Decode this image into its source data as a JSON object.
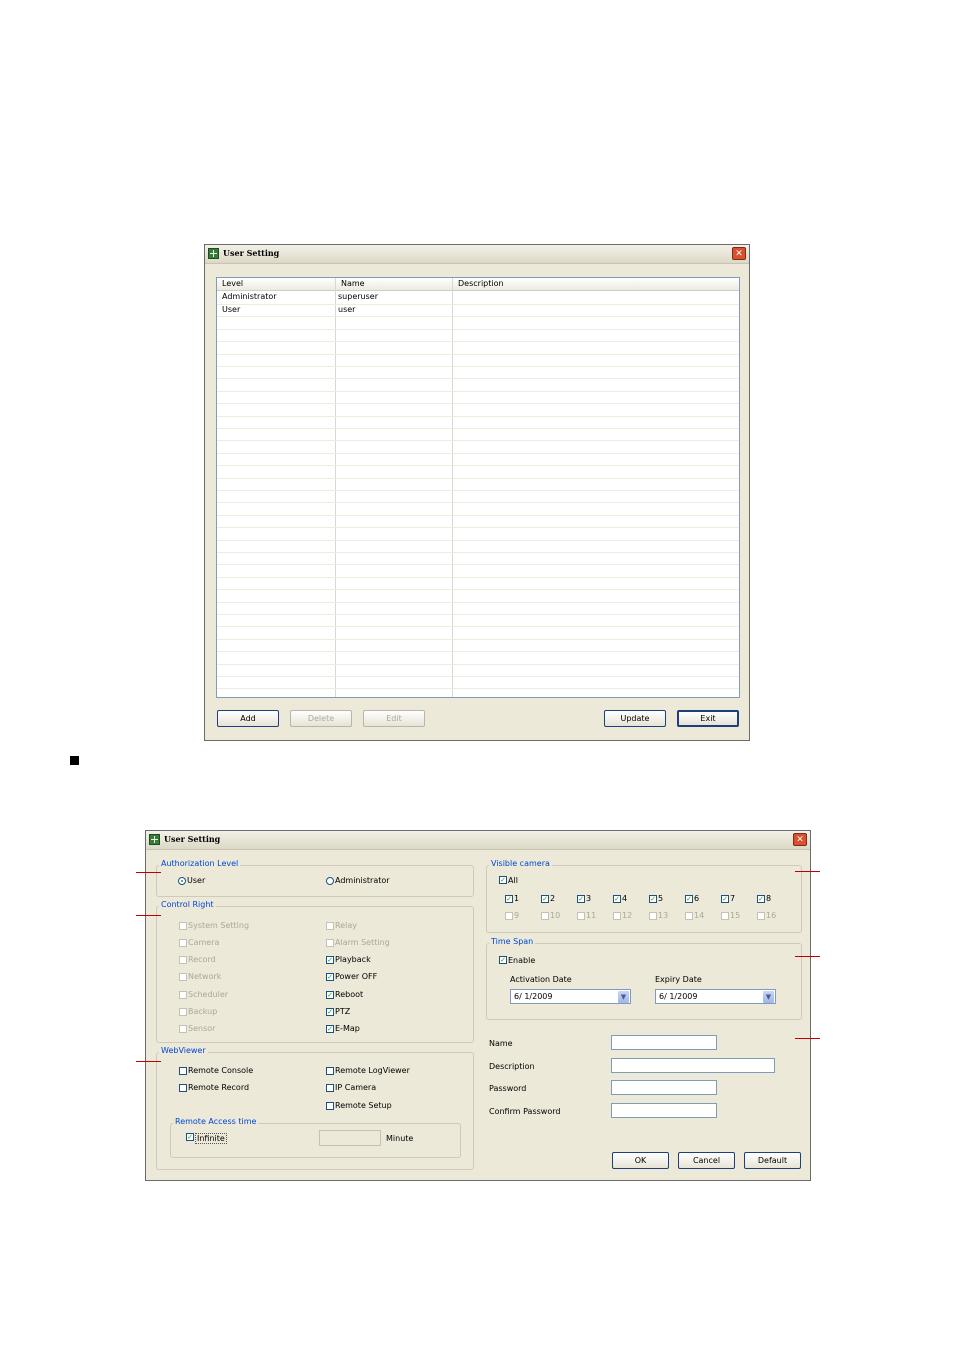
{
  "dialog1": {
    "title": "User Setting",
    "columns": [
      "Level",
      "Name",
      "Description"
    ],
    "rows": [
      {
        "level": "Administrator",
        "name": "superuser",
        "description": ""
      },
      {
        "level": "User",
        "name": "user",
        "description": ""
      }
    ],
    "buttons": {
      "add": "Add",
      "delete": "Delete",
      "edit": "Edit",
      "update": "Update",
      "exit": "Exit"
    }
  },
  "dialog2": {
    "title": "User Setting",
    "authorization": {
      "label": "Authorization Level",
      "user": "User",
      "administrator": "Administrator",
      "selected": "User"
    },
    "control_right": {
      "label": "Control Right",
      "left": [
        {
          "label": "System Setting",
          "checked": false,
          "enabled": false
        },
        {
          "label": "Camera",
          "checked": false,
          "enabled": false
        },
        {
          "label": "Record",
          "checked": false,
          "enabled": false
        },
        {
          "label": "Network",
          "checked": false,
          "enabled": false
        },
        {
          "label": "Scheduler",
          "checked": false,
          "enabled": false
        },
        {
          "label": "Backup",
          "checked": false,
          "enabled": false
        },
        {
          "label": "Sensor",
          "checked": false,
          "enabled": false
        }
      ],
      "right": [
        {
          "label": "Relay",
          "checked": false,
          "enabled": false
        },
        {
          "label": "Alarm Setting",
          "checked": false,
          "enabled": false
        },
        {
          "label": "Playback",
          "checked": true,
          "enabled": true
        },
        {
          "label": "Power OFF",
          "checked": true,
          "enabled": true
        },
        {
          "label": "Reboot",
          "checked": true,
          "enabled": true
        },
        {
          "label": "PTZ",
          "checked": true,
          "enabled": true
        },
        {
          "label": "E-Map",
          "checked": true,
          "enabled": true
        }
      ]
    },
    "webviewer": {
      "label": "WebViewer",
      "remote_console": "Remote Console",
      "remote_record": "Remote Record",
      "remote_logviewer": "Remote LogViewer",
      "ip_camera": "IP Camera",
      "remote_setup": "Remote Setup",
      "access_time_label": "Remote Access time",
      "infinite": "Infinite",
      "infinite_checked": true,
      "minute": "Minute",
      "minute_value": ""
    },
    "visible_camera": {
      "label": "Visible camera",
      "all": "All",
      "all_checked": true,
      "row1": [
        "1",
        "2",
        "3",
        "4",
        "5",
        "6",
        "7",
        "8"
      ],
      "row2": [
        "9",
        "10",
        "11",
        "12",
        "13",
        "14",
        "15",
        "16"
      ]
    },
    "time_span": {
      "label": "Time Span",
      "enable": "Enable",
      "enable_checked": true,
      "activation_label": "Activation Date",
      "activation_value": "6/ 1/2009",
      "expiry_label": "Expiry Date",
      "expiry_value": "6/ 1/2009"
    },
    "fields": {
      "name": "Name",
      "description": "Description",
      "password": "Password",
      "confirm_password": "Confirm Password"
    },
    "buttons": {
      "ok": "OK",
      "cancel": "Cancel",
      "default": "Default"
    }
  },
  "colors": {
    "callout": "#c00000",
    "group_label": "#0046d5",
    "check": "#21a121"
  }
}
